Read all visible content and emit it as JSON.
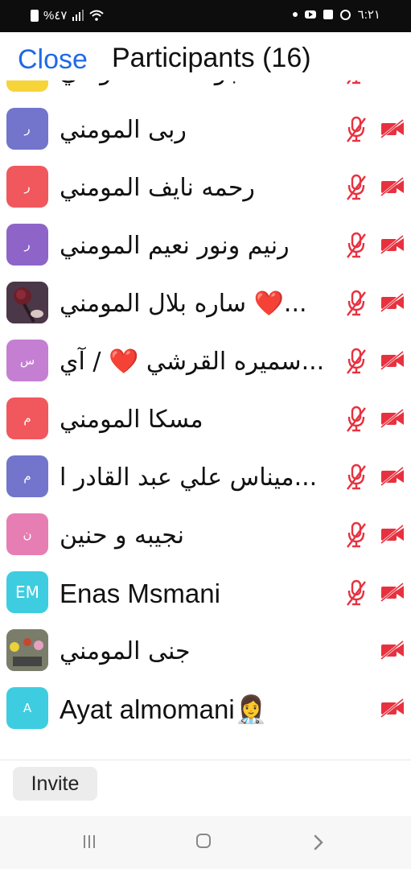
{
  "status_bar": {
    "left_text": "%٤٧",
    "time": "٦:٢١",
    "icons": [
      "battery-icon",
      "signal-icon",
      "wifi-icon",
      "dot-icon",
      "youtube-icon",
      "gallery-icon",
      "whatsapp-icon"
    ]
  },
  "header": {
    "close_label": "Close",
    "title": "Participants (16)"
  },
  "colors": {
    "accent": "#1f6ae6",
    "muted_red": "#e8313f",
    "avatar_purple": "#7275cb",
    "avatar_red": "#f0585d",
    "avatar_violet": "#8e64c9",
    "avatar_lilac": "#c47fd3",
    "avatar_pink": "#e67eb3",
    "avatar_cyan": "#3ecde0"
  },
  "participants": [
    {
      "name": "جود احمد المومني",
      "avatar": "",
      "avatar_color": "#f7d43a",
      "mic_muted": true,
      "cam_off": true,
      "partial": true
    },
    {
      "name": "ربى المومني",
      "avatar": "ر",
      "avatar_color": "#7275cb",
      "mic_muted": true,
      "cam_off": true
    },
    {
      "name": "رحمه نايف المومني",
      "avatar": "ر",
      "avatar_color": "#f0585d",
      "mic_muted": true,
      "cam_off": true
    },
    {
      "name": "رنيم ونور نعيم المومني",
      "avatar": "ر",
      "avatar_color": "#8e64c9",
      "mic_muted": true,
      "cam_off": true
    },
    {
      "name": "ساره  بلال المومني ❤️...",
      "avatar": "",
      "avatar_color": "#3a2a3a",
      "avatar_photo": "rose-photo",
      "mic_muted": true,
      "cam_off": true
    },
    {
      "name": "سميره القرشي ❤️ / آي...",
      "avatar": "س",
      "avatar_color": "#c47fd3",
      "mic_muted": true,
      "cam_off": true
    },
    {
      "name": "مسكا المومني",
      "avatar": "م",
      "avatar_color": "#f0585d",
      "mic_muted": true,
      "cam_off": true
    },
    {
      "name": "ميناس علي عبد القادر ا...",
      "avatar": "م",
      "avatar_color": "#7275cb",
      "mic_muted": true,
      "cam_off": true
    },
    {
      "name": "نجيبه و حنين",
      "avatar": "ن",
      "avatar_color": "#e67eb3",
      "mic_muted": true,
      "cam_off": true
    },
    {
      "name": "Enas Msmani",
      "avatar": "EM",
      "avatar_color": "#3ecde0",
      "mic_muted": true,
      "cam_off": true
    },
    {
      "name": "جنى المومني",
      "avatar": "",
      "avatar_color": "#6b6f5a",
      "avatar_photo": "flowers-photo",
      "mic_muted": false,
      "cam_off": true
    },
    {
      "name": "Ayat almomani👩‍⚕️",
      "avatar": "A",
      "avatar_color": "#3ecde0",
      "mic_muted": false,
      "cam_off": true
    }
  ],
  "bottom": {
    "invite_label": "Invite"
  },
  "nav": {
    "icons": [
      "recents-icon",
      "home-icon",
      "back-icon"
    ]
  }
}
